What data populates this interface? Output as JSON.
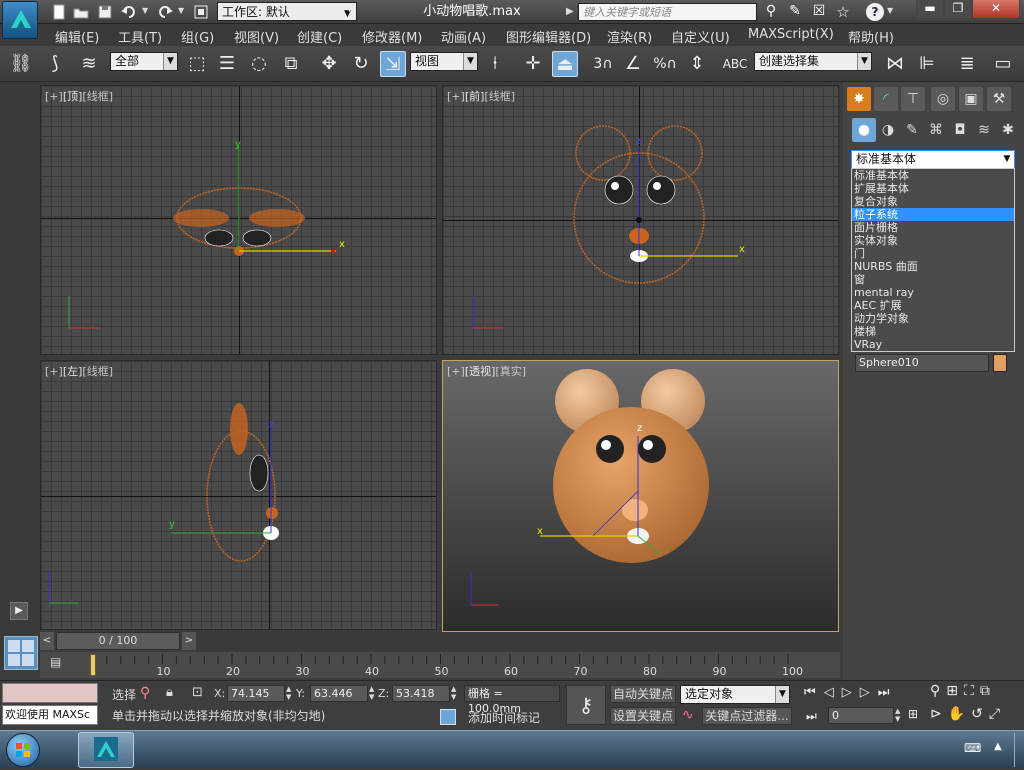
{
  "app": {
    "workspace_label": "工作区: 默认",
    "filename": "小动物唱歌.max",
    "search_placeholder": "键入关键字或短语"
  },
  "menu": [
    "编辑(E)",
    "工具(T)",
    "组(G)",
    "视图(V)",
    "创建(C)",
    "修改器(M)",
    "动画(A)",
    "图形编辑器(D)",
    "渲染(R)",
    "自定义(U)",
    "MAXScript(X)",
    "帮助(H)"
  ],
  "toolbar": {
    "selection_filter": "全部",
    "ref_coord": "视图",
    "named_selection": "创建选择集",
    "snap_angle": "3",
    "percent": "%"
  },
  "viewports": {
    "top": {
      "plus": "[+]",
      "name": "[顶]",
      "mode": "[线框]"
    },
    "front": {
      "plus": "[+]",
      "name": "[前]",
      "mode": "[线框]"
    },
    "left": {
      "plus": "[+]",
      "name": "[左]",
      "mode": "[线框]"
    },
    "persp": {
      "plus": "[+]",
      "name": "[透视]",
      "mode": "[真实]"
    }
  },
  "axes": {
    "x": "x",
    "y": "y",
    "z": "z"
  },
  "cmdpanel": {
    "category": "标准基本体",
    "options": [
      "标准基本体",
      "扩展基本体",
      "复合对象",
      "粒子系统",
      "面片栅格",
      "实体对象",
      "门",
      "NURBS 曲面",
      "窗",
      "mental ray",
      "AEC 扩展",
      "动力学对象",
      "楼梯",
      "VRay"
    ],
    "selected_index": 3,
    "object_name": "Sphere010",
    "object_color": "#e0a060"
  },
  "timeline": {
    "frame_label": "0 / 100",
    "ticks": [
      "10",
      "20",
      "30",
      "40",
      "50",
      "60",
      "70",
      "80",
      "90",
      "100"
    ]
  },
  "status": {
    "maxscript_label": "欢迎使用  MAXSc",
    "select_label": "选择",
    "x_label": "X:",
    "x_value": "74.145",
    "y_label": "Y:",
    "y_value": "63.446",
    "z_label": "Z:",
    "z_value": "53.418",
    "grid": "栅格 = 100.0mm",
    "hint": "单击并拖动以选择并缩放对象(非均匀地)",
    "add_time_tag": "添加时间标记",
    "auto_key": "自动关键点",
    "set_key": "设置关键点",
    "key_mode": "选定对象",
    "key_filters": "关键点过滤器...",
    "current_frame": "0"
  },
  "colors": {
    "accent": "#3390ff",
    "wire": "#c8641e",
    "selection_yellow": "#f0d000"
  }
}
